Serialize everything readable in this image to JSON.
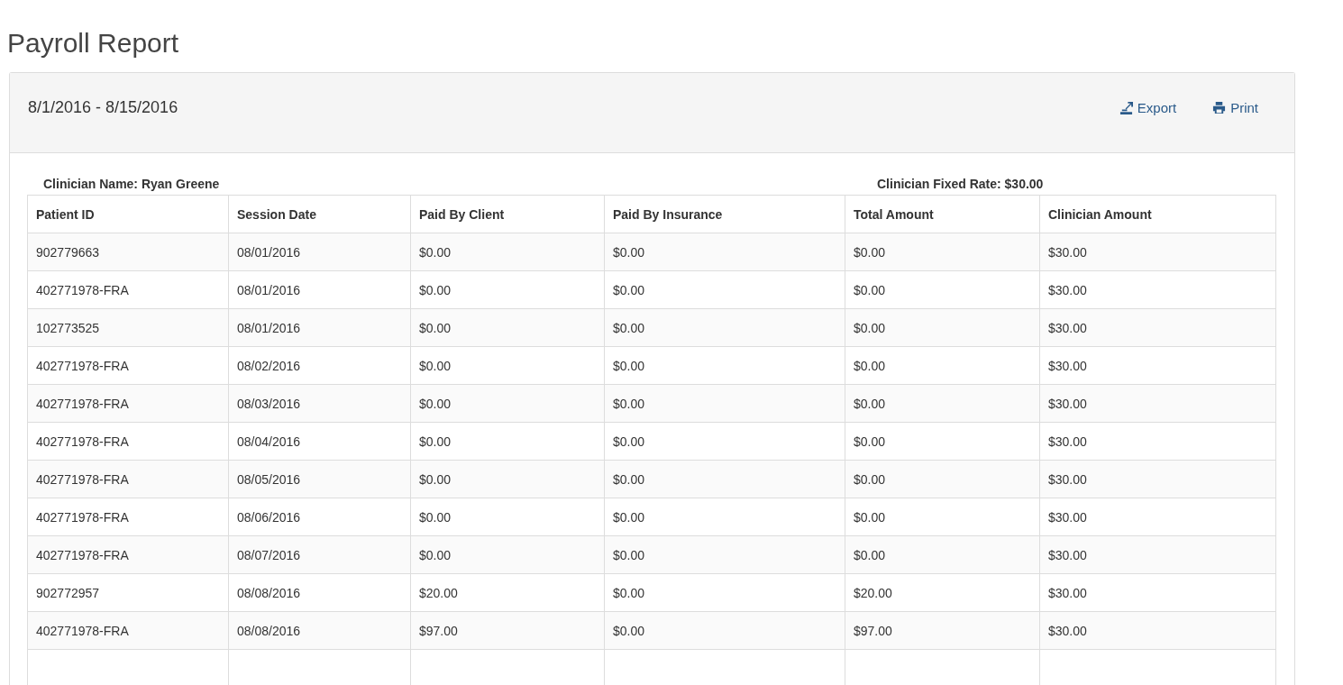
{
  "page_title": "Payroll Report",
  "panel": {
    "date_range": "8/1/2016 - 8/15/2016",
    "actions": [
      {
        "kind": "export",
        "label": "Export"
      },
      {
        "kind": "print",
        "label": "Print"
      }
    ]
  },
  "clinician_name": "Clinician Name: Ryan Greene",
  "clinician_rate": "Clinician Fixed Rate: $30.00",
  "table": {
    "columns": [
      "Patient ID",
      "Session Date",
      "Paid By Client",
      "Paid By Insurance",
      "Total Amount",
      "Clinician Amount"
    ],
    "rows": [
      [
        "902779663",
        "08/01/2016",
        "$0.00",
        "$0.00",
        "$0.00",
        "$30.00"
      ],
      [
        "402771978-FRA",
        "08/01/2016",
        "$0.00",
        "$0.00",
        "$0.00",
        "$30.00"
      ],
      [
        "102773525",
        "08/01/2016",
        "$0.00",
        "$0.00",
        "$0.00",
        "$30.00"
      ],
      [
        "402771978-FRA",
        "08/02/2016",
        "$0.00",
        "$0.00",
        "$0.00",
        "$30.00"
      ],
      [
        "402771978-FRA",
        "08/03/2016",
        "$0.00",
        "$0.00",
        "$0.00",
        "$30.00"
      ],
      [
        "402771978-FRA",
        "08/04/2016",
        "$0.00",
        "$0.00",
        "$0.00",
        "$30.00"
      ],
      [
        "402771978-FRA",
        "08/05/2016",
        "$0.00",
        "$0.00",
        "$0.00",
        "$30.00"
      ],
      [
        "402771978-FRA",
        "08/06/2016",
        "$0.00",
        "$0.00",
        "$0.00",
        "$30.00"
      ],
      [
        "402771978-FRA",
        "08/07/2016",
        "$0.00",
        "$0.00",
        "$0.00",
        "$30.00"
      ],
      [
        "902772957",
        "08/08/2016",
        "$20.00",
        "$0.00",
        "$20.00",
        "$30.00"
      ],
      [
        "402771978-FRA",
        "08/08/2016",
        "$97.00",
        "$0.00",
        "$97.00",
        "$30.00"
      ]
    ]
  }
}
